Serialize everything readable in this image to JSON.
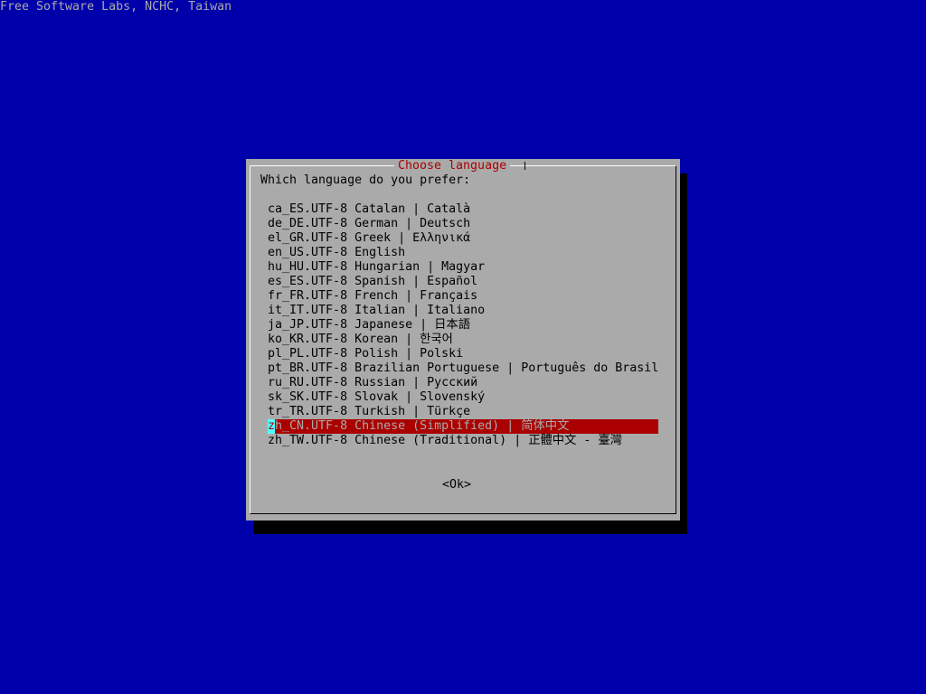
{
  "backtitle": "Free Software Labs, NCHC, Taiwan",
  "dialog": {
    "title": "Choose language",
    "prompt": "Which language do you prefer:",
    "ok_label": "<Ok>",
    "items": [
      {
        "label": "ca_ES.UTF-8 Catalan | Català"
      },
      {
        "label": "de_DE.UTF-8 German | Deutsch"
      },
      {
        "label": "el_GR.UTF-8 Greek | Ελληνικά"
      },
      {
        "label": "en_US.UTF-8 English"
      },
      {
        "label": "hu_HU.UTF-8 Hungarian | Magyar"
      },
      {
        "label": "es_ES.UTF-8 Spanish | Español"
      },
      {
        "label": "fr_FR.UTF-8 French | Français"
      },
      {
        "label": "it_IT.UTF-8 Italian | Italiano"
      },
      {
        "label": "ja_JP.UTF-8 Japanese | 日本語"
      },
      {
        "label": "ko_KR.UTF-8 Korean | 한국어"
      },
      {
        "label": "pl_PL.UTF-8 Polish | Polski"
      },
      {
        "label": "pt_BR.UTF-8 Brazilian Portuguese | Português do Brasil"
      },
      {
        "label": "ru_RU.UTF-8 Russian | Русский"
      },
      {
        "label": "sk_SK.UTF-8 Slovak | Slovenský"
      },
      {
        "label": "tr_TR.UTF-8 Turkish | Türkçe"
      },
      {
        "label": "zh_CN.UTF-8 Chinese (Simplified) | 简体中文",
        "selected": true
      },
      {
        "label": "zh_TW.UTF-8 Chinese (Traditional) | 正體中文 - 臺灣"
      }
    ]
  }
}
